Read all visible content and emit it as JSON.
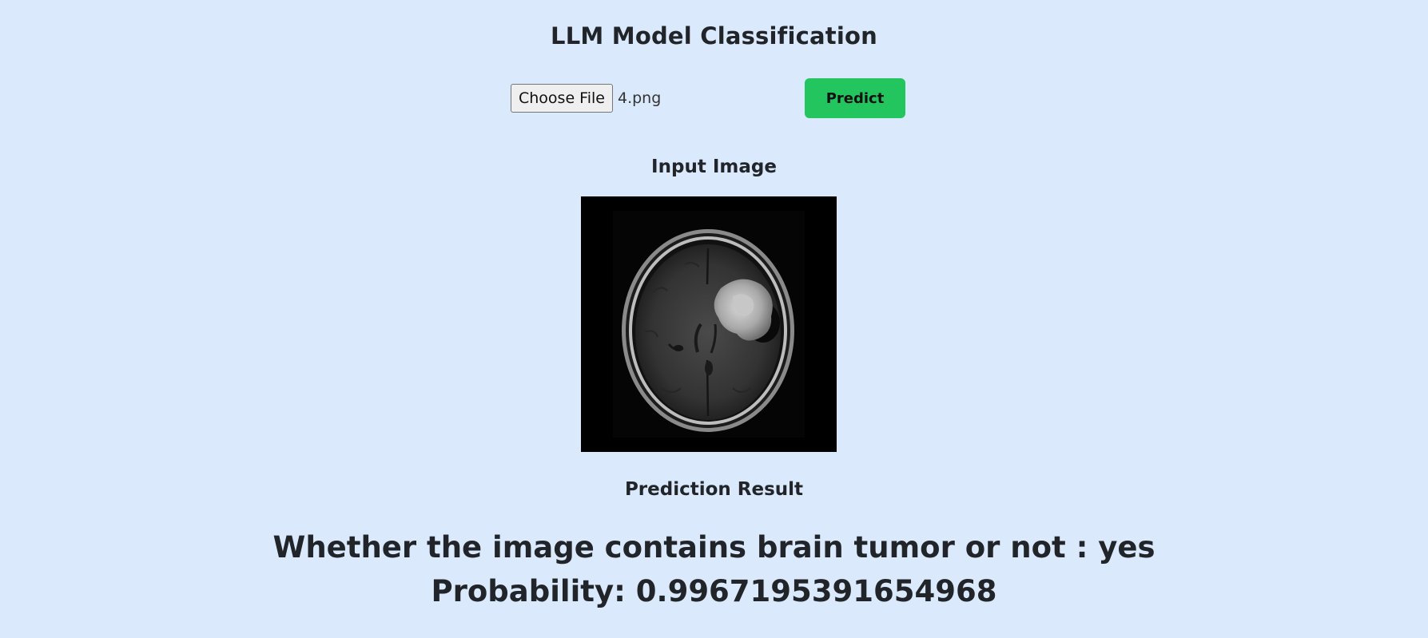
{
  "page": {
    "title": "LLM Model Classification"
  },
  "upload": {
    "choose_file_label": "Choose File",
    "file_name": "4.png",
    "predict_label": "Predict"
  },
  "input_section": {
    "heading": "Input Image",
    "image_alt": "brain MRI scan"
  },
  "result_section": {
    "heading": "Prediction Result",
    "answer_line": "Whether the image contains brain tumor or not : yes",
    "probability_line": "Probability: 0.9967195391654968"
  },
  "colors": {
    "background": "#dbe9fc",
    "predict_button": "#22c55e",
    "text": "#212529"
  }
}
